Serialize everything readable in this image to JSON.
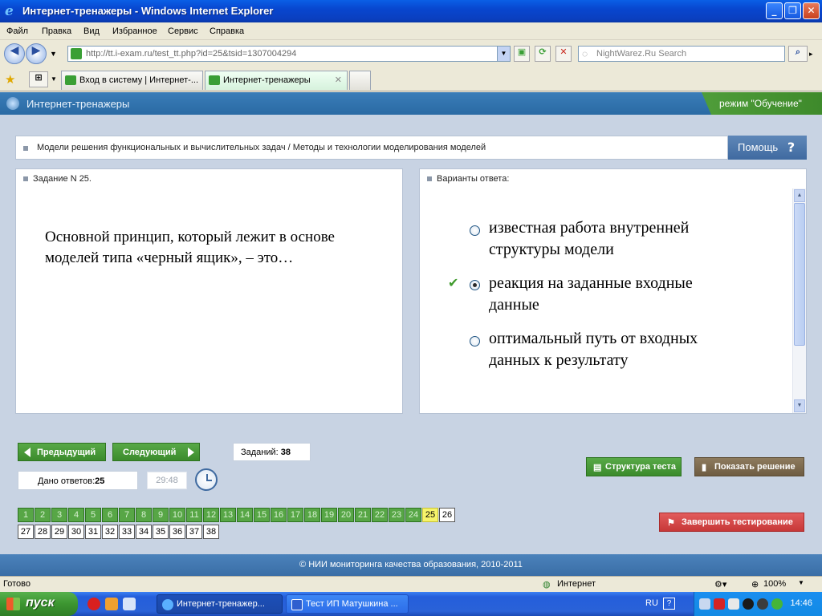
{
  "window": {
    "title": "Интернет-тренажеры - Windows Internet Explorer"
  },
  "menu": [
    "Файл",
    "Правка",
    "Вид",
    "Избранное",
    "Сервис",
    "Справка"
  ],
  "address": {
    "url": "http://tt.i-exam.ru/test_tt.php?id=25&tsid=1307004294",
    "search_placeholder": "NightWarez.Ru Search"
  },
  "tabs": [
    {
      "label": "Вход в систему | Интернет-..."
    },
    {
      "label": "Интернет-тренажеры"
    }
  ],
  "app": {
    "name": "Интернет-тренажеры",
    "mode": "режим \"Обучение\""
  },
  "topic": "Модели решения функциональных и вычислительных задач / Методы и технологии моделирования моделей",
  "help_label": "Помощь",
  "task": {
    "header": "Задание N 25.",
    "question": "Основной принцип, который лежит в основе моделей типа «черный ящик», – это…"
  },
  "answers": {
    "header": "Варианты ответа:",
    "options": [
      {
        "text": "известная работа внутренней структуры модели",
        "selected": false
      },
      {
        "text": "реакция на заданные входные данные",
        "selected": true
      },
      {
        "text": "оптимальный путь от входных данных к результату",
        "selected": false
      }
    ]
  },
  "controls": {
    "prev": "Предыдущий",
    "next": "Следующий",
    "tasks_label": "Заданий:",
    "tasks_count": "38",
    "answers_label": "Дано ответов:",
    "answers_count": "25",
    "timer": "29:48",
    "structure": "Структура теста",
    "show_solution": "Показать решение",
    "finish": "Завершить тестирование"
  },
  "questions": {
    "answered": [
      "1",
      "2",
      "3",
      "4",
      "5",
      "6",
      "7",
      "8",
      "9",
      "10",
      "11",
      "12",
      "13",
      "14",
      "15",
      "16",
      "17",
      "18",
      "19",
      "20",
      "21",
      "22",
      "23",
      "24"
    ],
    "current": "25",
    "remaining_row1": [
      "26"
    ],
    "remaining_row2": [
      "27",
      "28",
      "29",
      "30",
      "31",
      "32",
      "33",
      "34",
      "35",
      "36",
      "37",
      "38"
    ]
  },
  "footer": "© НИИ мониторинга качества образования, 2010-2011",
  "status": {
    "left": "Готово",
    "zone": "Интернет",
    "zoom": "100%"
  },
  "taskbar": {
    "start": "пуск",
    "items": [
      "Интернет-тренажер...",
      "Тест ИП Матушкина ..."
    ],
    "lang": "RU",
    "time": "14:46"
  },
  "colors": {
    "title_bar": "#0a5fe6",
    "app_header": "#2a6aa4",
    "content_bg": "#c8d3e3",
    "green_button": "#3b8b2c",
    "current_question": "#f6f46a",
    "finish_button": "#c73838"
  }
}
